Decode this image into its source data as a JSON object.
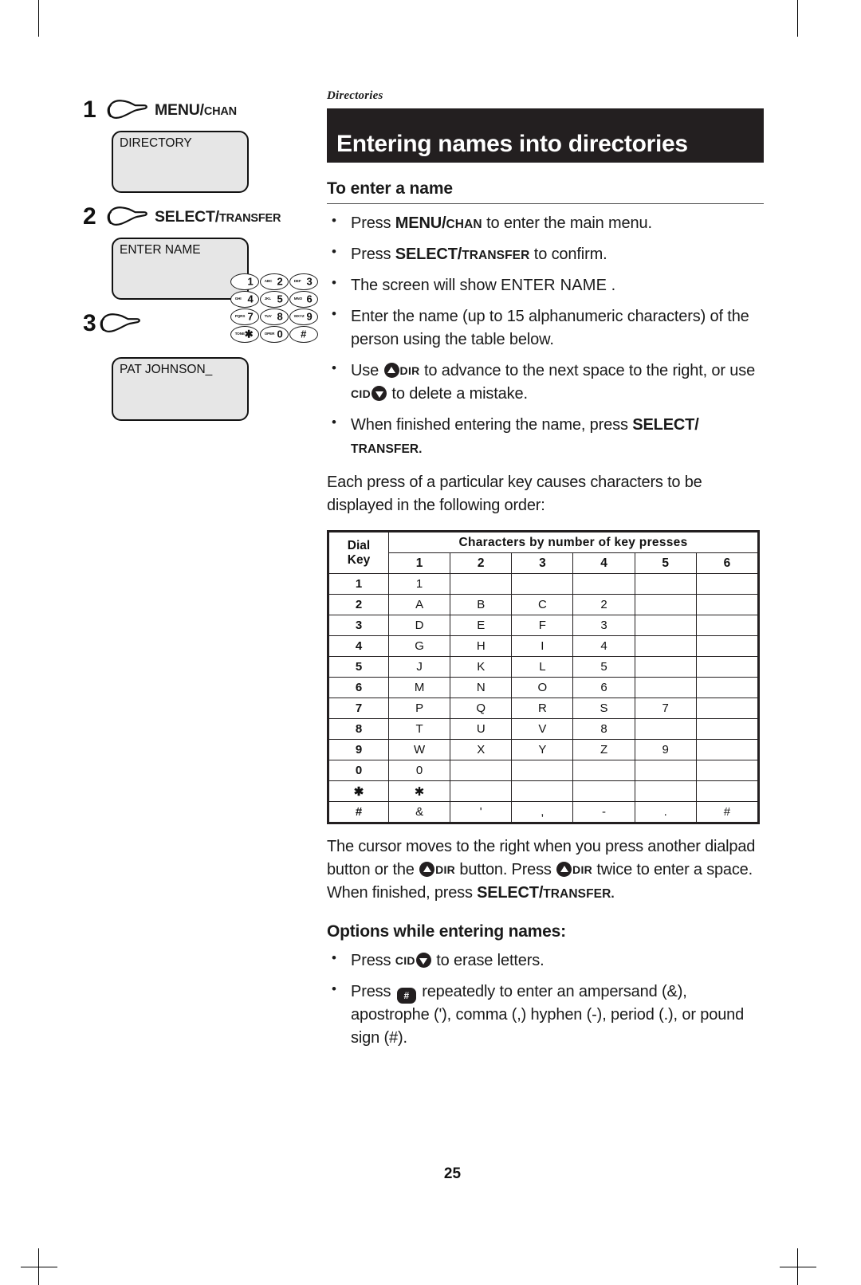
{
  "running_head": "Directories",
  "title": "Entering names into directories",
  "section_heading": "To enter a name",
  "steps": [
    {
      "number": "1",
      "button_main": "MENU/",
      "button_small": "CHAN",
      "lcd": "DIRECTORY"
    },
    {
      "number": "2",
      "button_main": "SELECT/",
      "button_small": "TRANSFER",
      "lcd": "ENTER NAME"
    },
    {
      "number": "3",
      "button_main": "",
      "button_small": "",
      "lcd": "PAT JOHNSON_"
    }
  ],
  "keypad": [
    {
      "letters": "",
      "digit": "1"
    },
    {
      "letters": "ABC",
      "digit": "2"
    },
    {
      "letters": "DEF",
      "digit": "3"
    },
    {
      "letters": "GHI",
      "digit": "4"
    },
    {
      "letters": "JKL",
      "digit": "5"
    },
    {
      "letters": "MNO",
      "digit": "6"
    },
    {
      "letters": "PQRS",
      "digit": "7"
    },
    {
      "letters": "TUV",
      "digit": "8"
    },
    {
      "letters": "WXYZ",
      "digit": "9"
    },
    {
      "letters": "TONE",
      "digit": "✱"
    },
    {
      "letters": "OPER",
      "digit": "0"
    },
    {
      "letters": "",
      "digit": "#"
    }
  ],
  "bullets": {
    "b1_pre": "Press ",
    "b1_btn_main": "MENU/",
    "b1_btn_small": "CHAN",
    "b1_post": " to enter the main menu.",
    "b2_pre": "Press ",
    "b2_btn_main": "SELECT/",
    "b2_btn_small": "TRANSFER",
    "b2_post": " to confirm.",
    "b3_pre": "The screen will show ",
    "b3_lcd": "ENTER NAME",
    "b3_post": "  .",
    "b4": "Enter the name (up to 15 alphanumeric characters) of the person using the table below.",
    "b5_pre": "Use ",
    "b5_dir": "DIR",
    "b5_mid": " to advance to the next space to the right, or use ",
    "b5_cid": "CID",
    "b5_post": " to delete a mistake.",
    "b6_pre": "When finished entering the name, press ",
    "b6_btn_main": "SELECT/",
    "b6_btn_small": "TRANSFER."
  },
  "paragraph_order": "Each press of a particular key causes characters to be displayed in the following order:",
  "cursor_paragraph": {
    "p1": "The cursor moves to the right when you press another dialpad button or the ",
    "dir1": "DIR",
    "p2": " button. Press ",
    "dir2": "DIR",
    "p3": " twice to enter a space. When finished, press ",
    "btn_main": "SELECT/",
    "btn_small": "TRANSFER."
  },
  "options_heading": "Options while entering names:",
  "options": {
    "o1_pre": "Press ",
    "o1_cid": "CID",
    "o1_post": " to erase letters.",
    "o2_pre": "Press ",
    "o2_post": " repeatedly to enter an ampersand (&), apostrophe ('), comma (,) hyphen (-), period (.), or pound sign (#)."
  },
  "chart_data": {
    "type": "table",
    "title": "Characters by number of key presses",
    "row_header_label_line1": "Dial",
    "row_header_label_line2": "Key",
    "columns": [
      "1",
      "2",
      "3",
      "4",
      "5",
      "6"
    ],
    "rows": [
      {
        "key": "1",
        "values": [
          "1",
          "",
          "",
          "",
          "",
          ""
        ]
      },
      {
        "key": "2",
        "values": [
          "A",
          "B",
          "C",
          "2",
          "",
          ""
        ]
      },
      {
        "key": "3",
        "values": [
          "D",
          "E",
          "F",
          "3",
          "",
          ""
        ]
      },
      {
        "key": "4",
        "values": [
          "G",
          "H",
          "I",
          "4",
          "",
          ""
        ]
      },
      {
        "key": "5",
        "values": [
          "J",
          "K",
          "L",
          "5",
          "",
          ""
        ]
      },
      {
        "key": "6",
        "values": [
          "M",
          "N",
          "O",
          "6",
          "",
          ""
        ]
      },
      {
        "key": "7",
        "values": [
          "P",
          "Q",
          "R",
          "S",
          "7",
          ""
        ]
      },
      {
        "key": "8",
        "values": [
          "T",
          "U",
          "V",
          "8",
          "",
          ""
        ]
      },
      {
        "key": "9",
        "values": [
          "W",
          "X",
          "Y",
          "Z",
          "9",
          ""
        ]
      },
      {
        "key": "0",
        "values": [
          "0",
          "",
          "",
          "",
          "",
          ""
        ]
      },
      {
        "key": "✱",
        "values": [
          "✱",
          "",
          "",
          "",
          "",
          ""
        ]
      },
      {
        "key": "#",
        "values": [
          "&",
          "'",
          ",",
          "-",
          ".",
          "#"
        ]
      }
    ]
  },
  "page_number": "25"
}
